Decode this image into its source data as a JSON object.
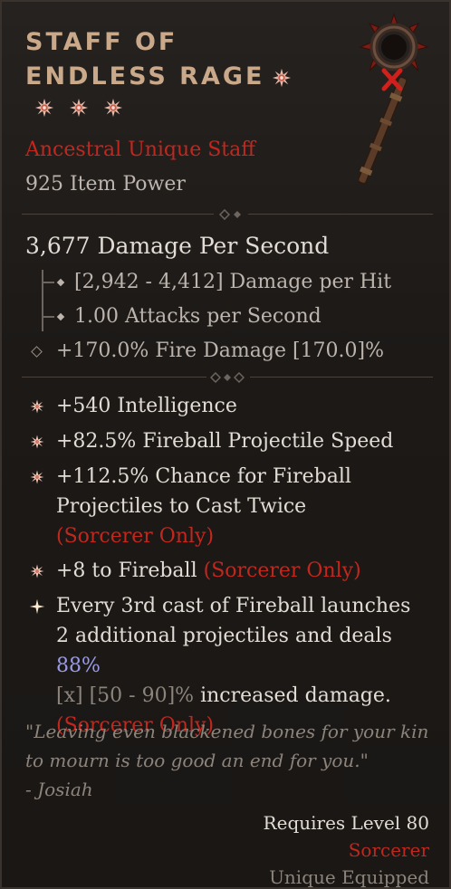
{
  "item": {
    "title_line1": "STAFF OF",
    "title_line2": "ENDLESS RAGE",
    "rarity": "Ancestral Unique Staff",
    "item_power": "925 Item Power",
    "dps": "3,677 Damage Per Second",
    "damage_per_hit": "[2,942 - 4,412] Damage per Hit",
    "attacks_per_second": "1.00 Attacks per Second",
    "implicit": "+170.0% Fire Damage [170.0]%",
    "affixes": [
      {
        "text": "+540 Intelligence"
      },
      {
        "text": "+82.5% Fireball Projectile Speed"
      },
      {
        "text": "+112.5% Chance for Fireball Projectiles to Cast Twice",
        "class_tag": "(Sorcerer Only)"
      },
      {
        "text": "+8 to Fireball",
        "class_tag": "(Sorcerer Only)"
      }
    ],
    "unique_power": {
      "part1": "Every 3rd cast of",
      "skill": "Fireball",
      "part2": "launches 2 additional projectiles and deals",
      "value": "88%",
      "range_x": "[x]",
      "range": "[50 - 90]%",
      "part3": "increased damage.",
      "class_tag": "(Sorcerer Only)"
    },
    "flavor": "\"Leaving even blackened bones for your kin to mourn is too good an end for you.\"",
    "flavor_author": "- Josiah",
    "requires_level": "Requires Level 80",
    "required_class": "Sorcerer",
    "unique_equipped": "Unique Equipped"
  },
  "colors": {
    "title": "#c9a98a",
    "unique_red": "#c2271e",
    "unique_gold": "#d8a15a",
    "value_blue": "#9a9ae8",
    "text": "#e2dcd5",
    "muted": "#8c847b"
  },
  "icons": [
    "greater-affix-star-icon",
    "affix-star-icon",
    "unique-power-star-icon",
    "staff-item-image"
  ]
}
